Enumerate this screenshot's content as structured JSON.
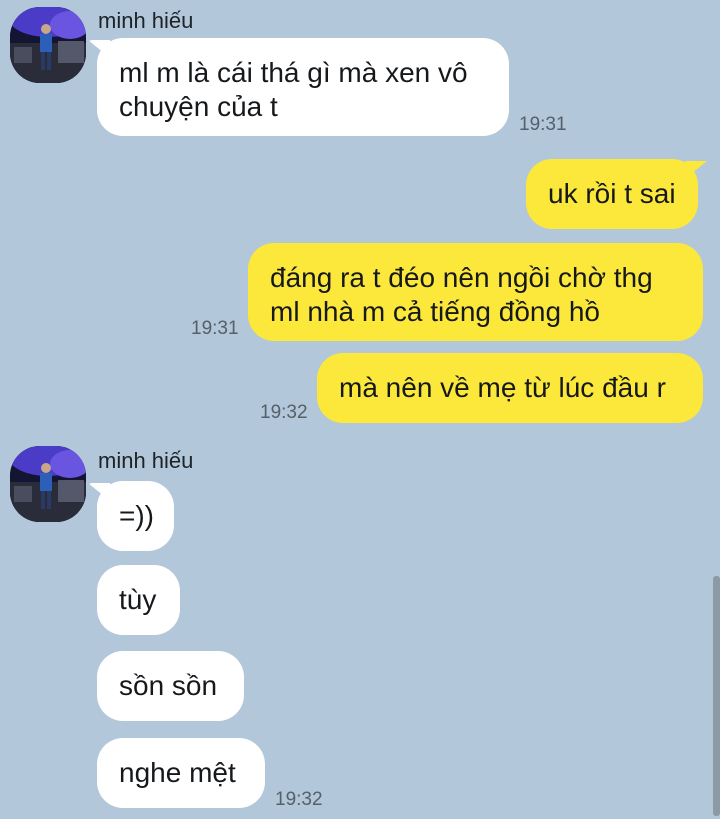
{
  "messages": [
    {
      "sender": "minh hiếu",
      "text": "ml m là cái thá gì mà xen vô\nchuyện của t",
      "time": "19:31"
    },
    {
      "text": "uk rồi t sai"
    },
    {
      "text": "đáng ra t đéo nên ngồi chờ thg\nml nhà m cả tiếng đồng hồ",
      "time": "19:31"
    },
    {
      "text": "mà nên về mẹ từ lúc đầu r",
      "time": "19:32"
    },
    {
      "sender": "minh hiếu",
      "text": "=))"
    },
    {
      "text": "tùy"
    },
    {
      "text": "sồn sồn"
    },
    {
      "text": "nghe mệt",
      "time": "19:32"
    }
  ],
  "colors": {
    "background": "#b2c7d9",
    "incoming_bubble": "#ffffff",
    "outgoing_bubble": "#fce83b"
  },
  "icons": {
    "avatar": "profile-photo-avatar",
    "scroll": "scrollbar"
  }
}
